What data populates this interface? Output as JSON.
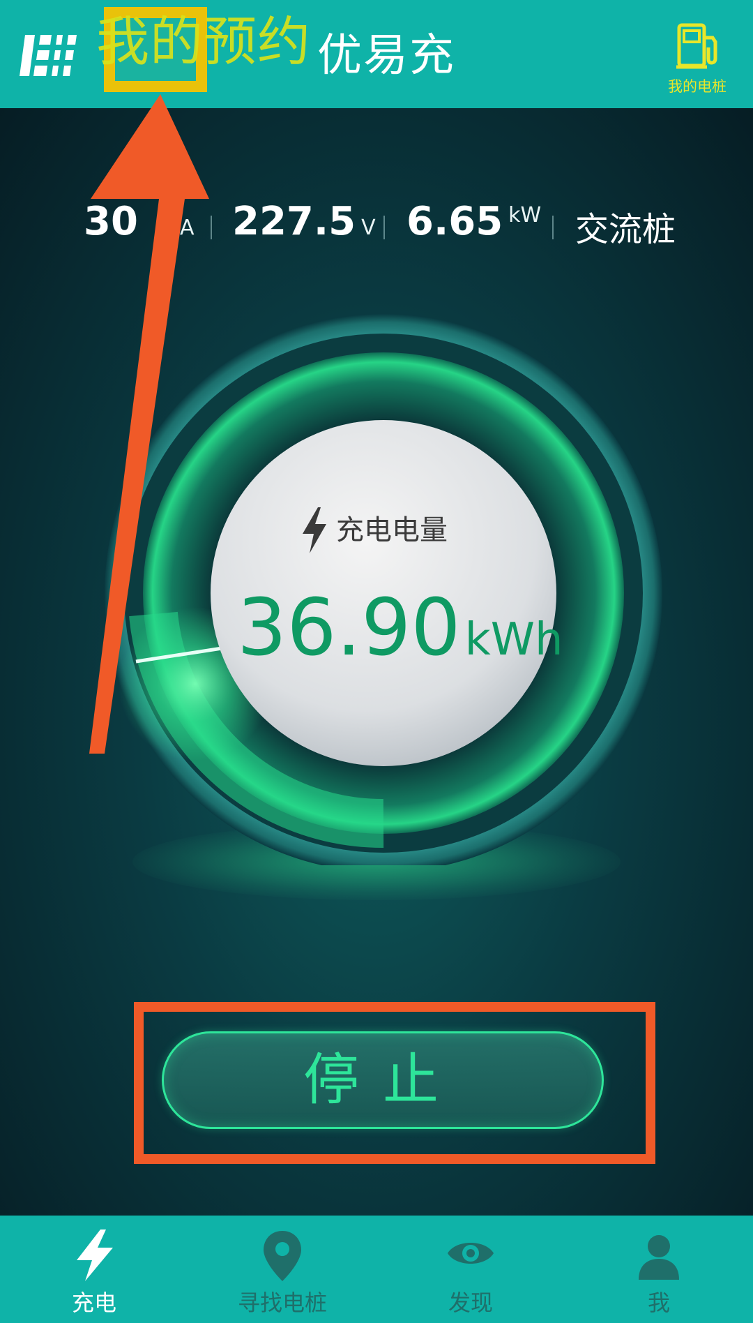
{
  "header": {
    "app_title": "优易充",
    "overlay_text": "我的预约",
    "my_station_label": "我的电桩",
    "logo_icon": "grid-logo-icon",
    "station_icon": "fuel-pump-icon"
  },
  "stats": {
    "current_value": "30",
    "current_unit": "A",
    "voltage_value": "227.5",
    "voltage_unit": "V",
    "power_value": "6.65",
    "power_unit": "kW",
    "station_type": "交流桩"
  },
  "gauge": {
    "label": "充电电量",
    "value": "36.90",
    "unit": "kWh",
    "icon": "lightning-icon"
  },
  "actions": {
    "stop_label": "停止"
  },
  "nav": {
    "items": [
      {
        "label": "充电",
        "icon": "lightning-icon",
        "active": true
      },
      {
        "label": "寻找电桩",
        "icon": "location-pin-icon",
        "active": false
      },
      {
        "label": "发现",
        "icon": "eye-icon",
        "active": false
      },
      {
        "label": "我",
        "icon": "user-icon",
        "active": false
      }
    ]
  },
  "colors": {
    "topbar": "#0fb3a8",
    "accent_green": "#2ee59a",
    "annotation_orange": "#f05a28",
    "annotation_yellow": "#e9c20a"
  }
}
